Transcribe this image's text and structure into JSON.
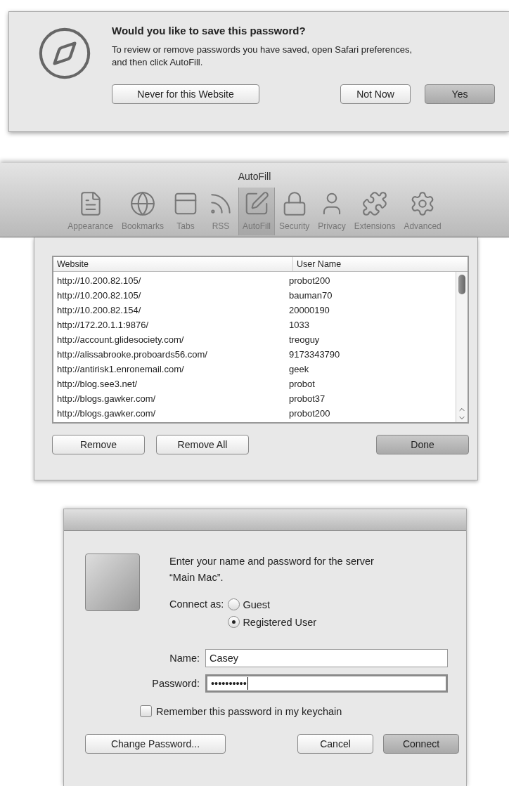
{
  "save_prompt": {
    "title": "Would you like to save this password?",
    "message": "To review or remove passwords you have saved, open Safari preferences, and then click AutoFill.",
    "buttons": [
      {
        "label": "Never for this Website",
        "default": false
      },
      {
        "label": "Not Now",
        "default": false
      },
      {
        "label": "Yes",
        "default": true
      }
    ]
  },
  "preferences": {
    "title": "AutoFill",
    "toolbar": [
      {
        "label": "Appearance",
        "selected": false
      },
      {
        "label": "Bookmarks",
        "selected": false
      },
      {
        "label": "Tabs",
        "selected": false
      },
      {
        "label": "RSS",
        "selected": false
      },
      {
        "label": "AutoFill",
        "selected": true
      },
      {
        "label": "Security",
        "selected": false
      },
      {
        "label": "Privacy",
        "selected": false
      },
      {
        "label": "Extensions",
        "selected": false
      },
      {
        "label": "Advanced",
        "selected": false
      }
    ],
    "table": {
      "columns": [
        "Website",
        "User Name"
      ],
      "rows": [
        [
          "http://10.200.82.105/",
          "probot200"
        ],
        [
          "http://10.200.82.105/",
          "bauman70"
        ],
        [
          "http://10.200.82.154/",
          "20000190"
        ],
        [
          "http://172.20.1.1:9876/",
          "1033"
        ],
        [
          "http://account.glidesociety.com/",
          "treoguy"
        ],
        [
          "http://alissabrooke.proboards56.com/",
          "9173343790"
        ],
        [
          "http://antirisk1.enronemail.com/",
          "geek"
        ],
        [
          "http://blog.see3.net/",
          "probot"
        ],
        [
          "http://blogs.gawker.com/",
          "probot37"
        ],
        [
          "http://blogs.gawker.com/",
          "probot200"
        ]
      ]
    },
    "buttons": [
      {
        "label": "Remove",
        "default": false
      },
      {
        "label": "Remove All",
        "default": false
      },
      {
        "label": "Done",
        "default": true
      }
    ]
  },
  "login": {
    "message": "Enter your name and password for the server “Main Mac”.",
    "connect_label": "Connect as:",
    "options": [
      {
        "label": "Guest",
        "selected": false
      },
      {
        "label": "Registered User",
        "selected": true
      }
    ],
    "fields": [
      {
        "label": "Name:",
        "value": "Casey",
        "focused": false
      },
      {
        "label": "Password:",
        "value": "••••••••••",
        "focused": true
      }
    ],
    "remember": {
      "label": "Remember this password in my keychain",
      "checked": false
    },
    "buttons": [
      {
        "label": "Change Password...",
        "default": false
      },
      {
        "label": "Cancel",
        "default": false
      },
      {
        "label": "Connect",
        "default": true
      }
    ]
  }
}
